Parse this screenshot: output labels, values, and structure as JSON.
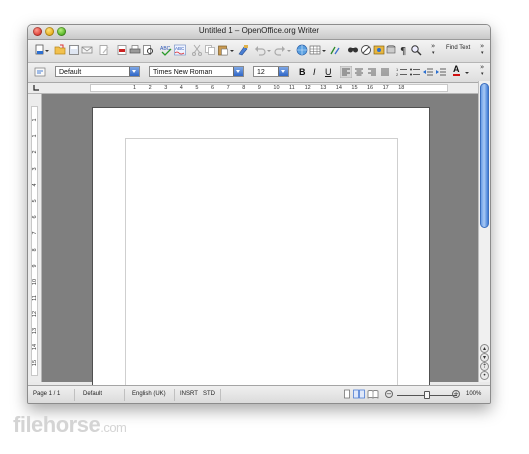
{
  "window": {
    "title": "Untitled 1 – OpenOffice.org Writer"
  },
  "toolbar": {
    "find_text": "Find Text",
    "more_glyph": "»"
  },
  "formatting": {
    "paragraph_style": "Default",
    "font_name": "Times New Roman",
    "font_size": "12",
    "bold": "B",
    "italic": "I",
    "underline": "U",
    "font_color_label": "A"
  },
  "ruler": {
    "marks": [
      "1",
      "2",
      "3",
      "4",
      "5",
      "6",
      "7",
      "8",
      "9",
      "10",
      "11",
      "12",
      "13",
      "14",
      "15",
      "16",
      "17",
      "18"
    ],
    "vertical_marks": [
      "1",
      "1",
      "2",
      "3",
      "4",
      "5",
      "6",
      "7",
      "8",
      "9",
      "10",
      "11",
      "12",
      "13",
      "14",
      "15"
    ]
  },
  "statusbar": {
    "page": "Page 1 / 1",
    "page_style": "Default",
    "language": "English (UK)",
    "insert_mode": "INSRT",
    "selection_mode": "STD",
    "zoom": "100%",
    "zoom_level": 0.5
  },
  "watermark": {
    "brand": "filehorse",
    "tld": ".com"
  },
  "colors": {
    "accent_blue": "#3f7bd6",
    "doc_background": "#7f7f7f",
    "font_color": "#d01010"
  }
}
